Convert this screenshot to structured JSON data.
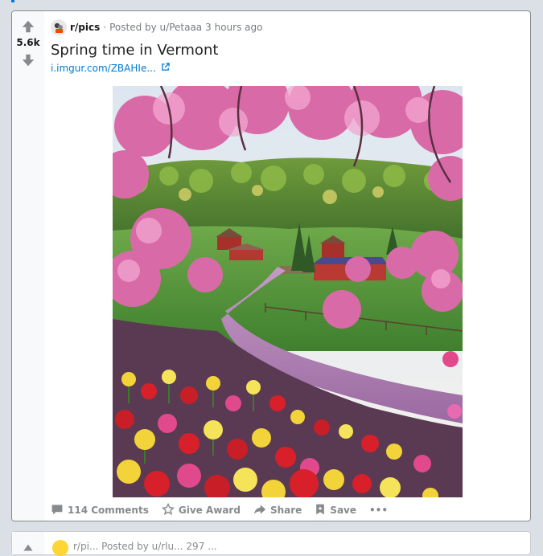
{
  "post": {
    "score": "5.6k",
    "subreddit": "r/pics",
    "posted_by": "Posted by u/Petaaa",
    "time": "3 hours ago",
    "title": "Spring time in Vermont",
    "link_text": "i.imgur.com/ZBAHIe...",
    "image_alt": "Spring time in Vermont"
  },
  "actions": {
    "comments": "114 Comments",
    "award": "Give Award",
    "share": "Share",
    "save": "Save",
    "more": "•••"
  },
  "next_post": {
    "meta": "r/pi... Posted by u/rlu... 297 ..."
  },
  "colors": {
    "accent": "#0079d3",
    "background": "#dae0e6",
    "vote_gray": "#878a8c"
  },
  "icons": {
    "upvote": "arrow-up-icon",
    "downvote": "arrow-down-icon",
    "comment": "comment-icon",
    "award": "award-icon",
    "share": "share-icon",
    "save": "bookmark-icon",
    "external": "external-link-icon"
  }
}
